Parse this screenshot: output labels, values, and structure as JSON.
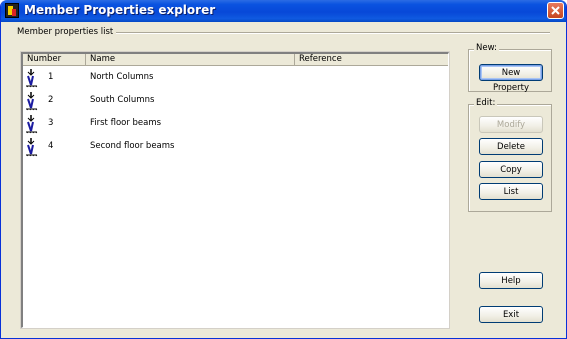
{
  "window": {
    "title": "Member Properties explorer"
  },
  "list_group": {
    "label": "Member properties list"
  },
  "list": {
    "columns": [
      "Number",
      "Name",
      "Reference"
    ],
    "rows": [
      {
        "number": "1",
        "name": "North Columns",
        "reference": ""
      },
      {
        "number": "2",
        "name": "South Columns",
        "reference": ""
      },
      {
        "number": "3",
        "name": "First floor beams",
        "reference": ""
      },
      {
        "number": "4",
        "name": "Second floor beams",
        "reference": ""
      }
    ],
    "row_icon": "member-property-icon"
  },
  "new_group": {
    "label": "New:",
    "new_property": "New Property"
  },
  "edit_group": {
    "label": "Edit:",
    "modify": "Modify",
    "delete": "Delete",
    "copy": "Copy",
    "list": "List"
  },
  "footer": {
    "help": "Help",
    "exit": "Exit"
  },
  "colors": {
    "titlebar": "#0a53e0",
    "window_bg": "#ece9d8",
    "close_button": "#c5451f"
  }
}
